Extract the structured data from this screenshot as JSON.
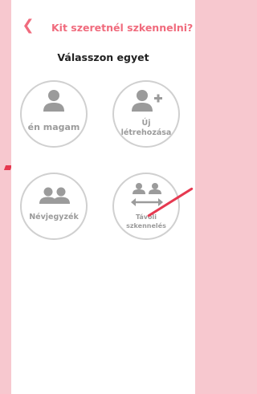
{
  "header": {
    "back_icon": "chevron-left-icon",
    "title": "Kit szeretnél szkennelni?"
  },
  "subtitle": "Válasszon egyet",
  "options": [
    {
      "id": "self",
      "label": "én magam",
      "icon": "person-icon"
    },
    {
      "id": "new",
      "label_line1": "Új",
      "label_line2": "létrehozása",
      "icon": "person-add-icon"
    },
    {
      "id": "contacts",
      "label": "Névjegyzék",
      "icon": "people-icon"
    },
    {
      "id": "remote",
      "label_line1": "Távoli",
      "label_line2": "szkennelés",
      "icon": "remote-people-icon"
    }
  ],
  "colors": {
    "accent": "#f06b7d",
    "circle_border": "#d0d0d0",
    "icon_gray": "#9b9b9b",
    "background_pink": "#f7c8cf"
  }
}
